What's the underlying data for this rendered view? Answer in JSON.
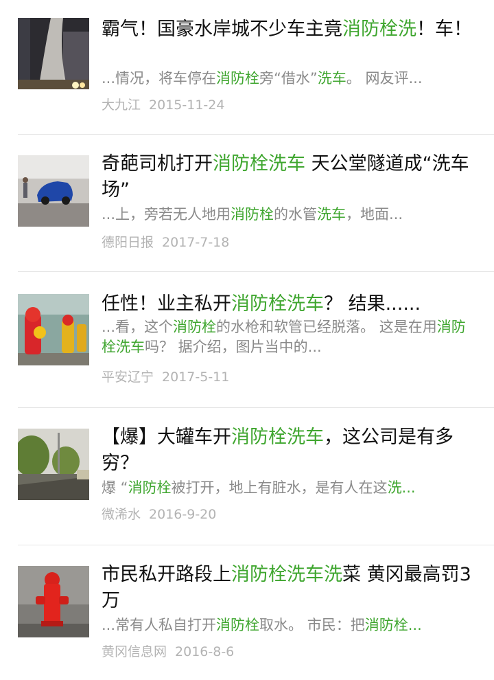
{
  "colors": {
    "highlight": "#3fa62f",
    "title": "#111111",
    "snippet": "#8a8a8a",
    "meta": "#b3b3b3"
  },
  "results": [
    {
      "thumbnail": "hydrant-water-spray-night-photo",
      "title": [
        {
          "t": "霸气！国豪水岸城不少车主竟",
          "hl": false
        },
        {
          "t": "消防栓洗",
          "hl": true
        },
        {
          "t": "！车！",
          "hl": false
        }
      ],
      "snippet": [
        {
          "t": "...情况，将车停在",
          "hl": false
        },
        {
          "t": "消防栓",
          "hl": true
        },
        {
          "t": "旁“借水”",
          "hl": false
        },
        {
          "t": "洗车",
          "hl": true
        },
        {
          "t": "。 网友评...",
          "hl": false
        }
      ],
      "source": "大九江",
      "date": "2015-11-24"
    },
    {
      "thumbnail": "blue-car-tunnel-photo",
      "title": [
        {
          "t": "奇葩司机打开",
          "hl": false
        },
        {
          "t": "消防栓洗车",
          "hl": true
        },
        {
          "t": " 天公堂隧道成“洗车场”",
          "hl": false
        }
      ],
      "snippet": [
        {
          "t": "...上，旁若无人地用",
          "hl": false
        },
        {
          "t": "消防栓",
          "hl": true
        },
        {
          "t": "的水管",
          "hl": false
        },
        {
          "t": "洗车",
          "hl": true
        },
        {
          "t": "，地面...",
          "hl": false
        }
      ],
      "source": "德阳日报",
      "date": "2017-7-18"
    },
    {
      "thumbnail": "decorated-hydrants-photo",
      "title": [
        {
          "t": "任性！业主私开",
          "hl": false
        },
        {
          "t": "消防栓洗车",
          "hl": true
        },
        {
          "t": "？ 结果......",
          "hl": false
        }
      ],
      "snippet": [
        {
          "t": "...看，这个",
          "hl": false
        },
        {
          "t": "消防栓",
          "hl": true
        },
        {
          "t": "的水枪和软管已经脱落。 这是在用",
          "hl": false
        },
        {
          "t": "消防栓洗车",
          "hl": true
        },
        {
          "t": "吗？ 据介绍，图片当中的...",
          "hl": false
        }
      ],
      "source": "平安辽宁",
      "date": "2017-5-11"
    },
    {
      "thumbnail": "street-trees-wet-road-photo",
      "title": [
        {
          "t": "【爆】大罐车开",
          "hl": false
        },
        {
          "t": "消防栓洗车",
          "hl": true
        },
        {
          "t": "，这公司是有多穷？",
          "hl": false
        }
      ],
      "snippet": [
        {
          "t": "爆 “",
          "hl": false
        },
        {
          "t": "消防栓",
          "hl": true
        },
        {
          "t": "被打开，地上有脏水，是有人在这",
          "hl": false
        },
        {
          "t": "洗...",
          "hl": true
        }
      ],
      "source": "微浠水",
      "date": "2016-9-20"
    },
    {
      "thumbnail": "red-fire-hydrant-photo",
      "title": [
        {
          "t": "市民私开路段上",
          "hl": false
        },
        {
          "t": "消防栓洗车洗",
          "hl": true
        },
        {
          "t": "菜 黄冈最高罚3万",
          "hl": false
        }
      ],
      "snippet": [
        {
          "t": "...常有人私自打开",
          "hl": false
        },
        {
          "t": "消防栓",
          "hl": true
        },
        {
          "t": "取水。 市民：把",
          "hl": false
        },
        {
          "t": "消防栓...",
          "hl": true
        }
      ],
      "source": "黄冈信息网",
      "date": "2016-8-6"
    }
  ]
}
